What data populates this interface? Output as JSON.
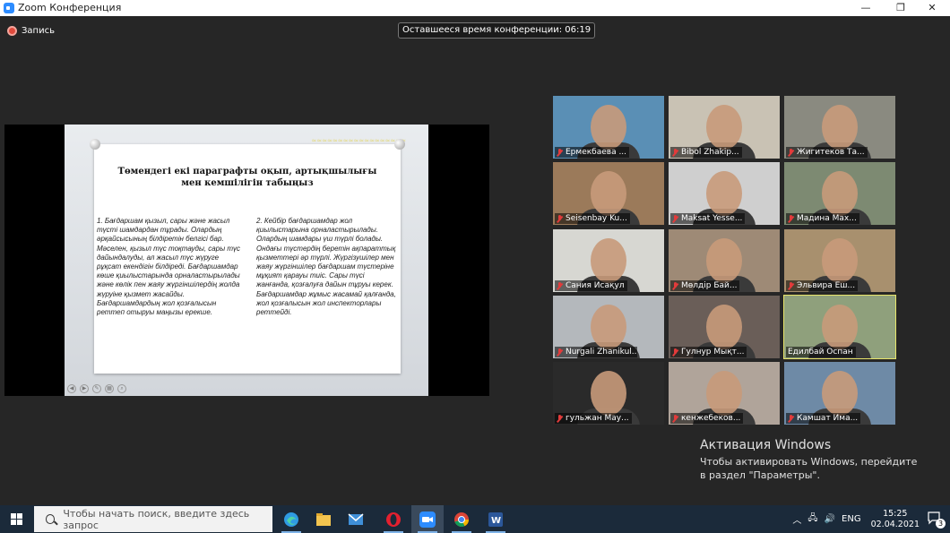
{
  "window": {
    "title": "Zoom Конференция",
    "controls": {
      "minimize": "—",
      "maximize": "❐",
      "close": "✕"
    }
  },
  "toolbar": {
    "recording_label": "Запись",
    "timer_text": "Оставшееся время конференции: 06:19"
  },
  "slide": {
    "heading": "Төмендегі екі параграфты оқып, артықшылығы мен кемшілігін табыңыз",
    "column1": "1. Бағдаршам қызыл, сары және жасыл түсті шамдардан тұрады. Олардың әрқайсысының білдіретін белгісі бар. Мәселен, қызыл түс тоқтауды, сары түс дайындалуды, ал жасыл түс жүруге рұқсат екендігін білдіреді. Бағдаршамдар көше қиылыстарында орналастырылады және көлік пен жаяу жүргіншілердің жолда жүруіне қызмет жасайды. Бағдаршамдардың жол қозғалысын реттеп отыруы маңызы ерекше.",
    "column2": "2. Кейбір бағдаршамдар жол қиылыстарына орналастырылады. Олардың шамдары үш түрлі болады. Ондағы түстердің беретін ақпараттық қызметтері әр түрлі. Жүргізушілер мен жаяу жүргіншілер бағдаршам түстеріне мұқият қарауы тиіс. Сары түсі жанғанда, қозғалуға дайын тұруы керек. Бағдаршамдар жұмыс жасамай қалғанда, жол қозғалысын жол инспекторлары реттейді."
  },
  "participants": [
    {
      "name": "Ермекбаева ...",
      "muted": true,
      "bg": "#5a8fb5"
    },
    {
      "name": "Bibol Zhakip...",
      "muted": true,
      "bg": "#c9c2b4"
    },
    {
      "name": "Жигитеков Та...",
      "muted": true,
      "bg": "#8a8a80"
    },
    {
      "name": "Seisenbay Ku...",
      "muted": true,
      "bg": "#9b7a5a"
    },
    {
      "name": "Maksat Yesse...",
      "muted": true,
      "bg": "#cfcfcf"
    },
    {
      "name": "Мадина Мах...",
      "muted": true,
      "bg": "#7d8a72"
    },
    {
      "name": "Сания Исақул",
      "muted": true,
      "bg": "#d7d7d2"
    },
    {
      "name": "Мөлдір Бай...",
      "muted": true,
      "bg": "#9e8a76"
    },
    {
      "name": "Эльвира Еш...",
      "muted": true,
      "bg": "#a8906e"
    },
    {
      "name": "Nurgali Zhanikul...",
      "muted": true,
      "bg": "#b4b8bc"
    },
    {
      "name": "Гулнур Мықт...",
      "muted": true,
      "bg": "#6a5e58"
    },
    {
      "name": "Едилбай Оспан",
      "muted": false,
      "bg": "#8fa07c"
    },
    {
      "name": "гульжан Мау...",
      "muted": true,
      "bg": "#2a2a2a"
    },
    {
      "name": "кенжебеков...",
      "muted": true,
      "bg": "#b0a49a"
    },
    {
      "name": "Камшат Има...",
      "muted": true,
      "bg": "#6e8aa6"
    }
  ],
  "activation": {
    "title": "Активация Windows",
    "text": "Чтобы активировать Windows, перейдите в раздел \"Параметры\"."
  },
  "taskbar": {
    "search_placeholder": "Чтобы начать поиск, введите здесь запрос",
    "apps": [
      "edge-icon",
      "file-explorer-icon",
      "mail-icon",
      "opera-icon",
      "zoom-icon",
      "chrome-icon",
      "word-icon"
    ],
    "language": "ENG",
    "time": "15:25",
    "date": "02.04.2021",
    "notifications": "3"
  }
}
